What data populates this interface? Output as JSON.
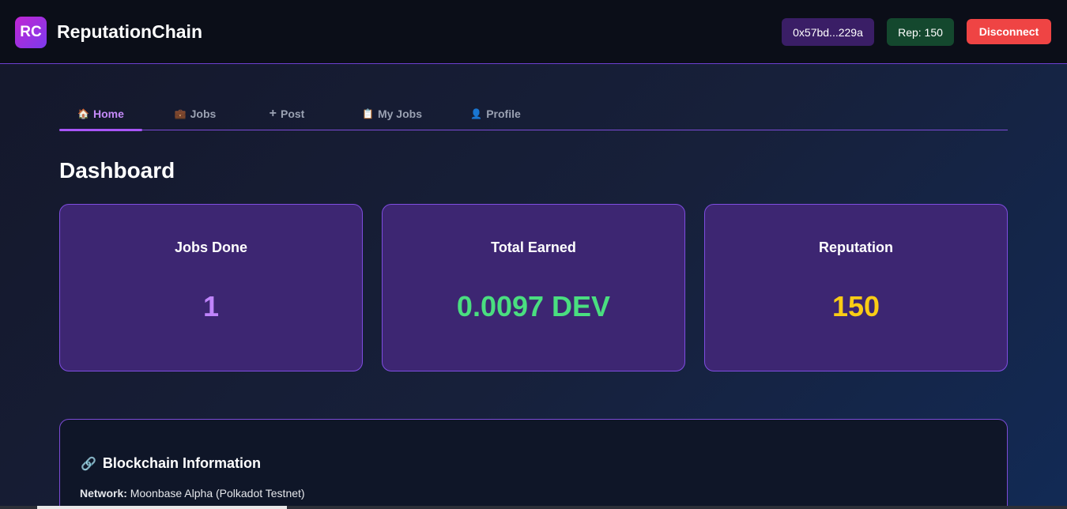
{
  "header": {
    "logo": "RC",
    "title": "ReputationChain",
    "wallet_address": "0x57bd...229a",
    "reputation_badge": "Rep: 150",
    "disconnect_label": "Disconnect"
  },
  "tabs": [
    {
      "icon": "home-icon",
      "glyph": "🏠",
      "label": "Home",
      "active": true
    },
    {
      "icon": "briefcase-icon",
      "glyph": "💼",
      "label": "Jobs",
      "active": false
    },
    {
      "icon": "plus-icon",
      "glyph": "➕",
      "label": "Post",
      "active": false
    },
    {
      "icon": "clipboard-icon",
      "glyph": "📋",
      "label": "My Jobs",
      "active": false
    },
    {
      "icon": "user-icon",
      "glyph": "👤",
      "label": "Profile",
      "active": false
    }
  ],
  "dashboard": {
    "title": "Dashboard",
    "stats": [
      {
        "label": "Jobs Done",
        "value": "1",
        "color": "#c084fc"
      },
      {
        "label": "Total Earned",
        "value": "0.0097 DEV",
        "color": "#4ade80"
      },
      {
        "label": "Reputation",
        "value": "150",
        "color": "#facc15"
      }
    ]
  },
  "blockchain_info": {
    "icon": "link-icon",
    "glyph": "🔗",
    "title": "Blockchain Information",
    "network_label": "Network:",
    "network_value": "Moonbase Alpha (Polkadot Testnet)"
  },
  "colors": {
    "accent": "#a855f7",
    "danger": "#ef4444",
    "card_bg": "#3d2672"
  }
}
